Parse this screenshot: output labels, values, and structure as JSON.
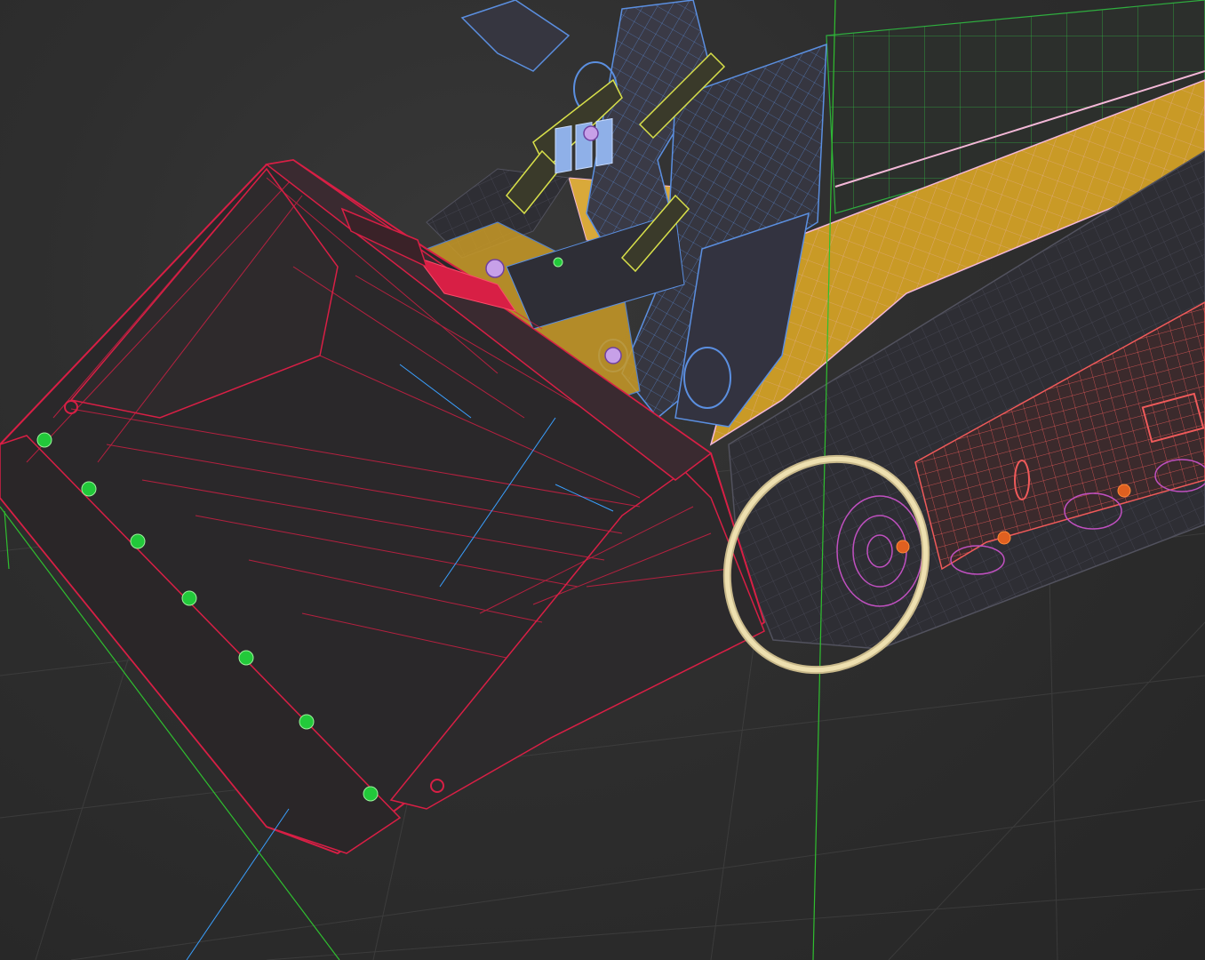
{
  "viewport": {
    "background": "#2b2b2b",
    "grid_color": "#4a4a4a"
  },
  "objects": [
    {
      "name": "bucket",
      "wire_color": "#d81f45"
    },
    {
      "name": "lift-arm",
      "wire_color": "#5b8fe0"
    },
    {
      "name": "body-panel",
      "wire_color": "#f4b8d8",
      "fill": "#c99a26"
    },
    {
      "name": "track",
      "wire_color": "#3a3a46"
    },
    {
      "name": "track-frame",
      "wire_color": "#f05a5a"
    },
    {
      "name": "road-wheels",
      "wire_color": "#c050c0"
    },
    {
      "name": "hydraulic-cylinders",
      "wire_color": "#d8e04a"
    },
    {
      "name": "hoses",
      "wire_color": "#e06020"
    },
    {
      "name": "bolts",
      "wire_color": "#22c93a"
    },
    {
      "name": "valve-block",
      "wire_color": "#8fb0e8"
    }
  ],
  "selection_ring": {
    "color": "#eee0b0"
  },
  "axes": {
    "x_color": "#2fbf2f",
    "y_color": "#2fbf2f",
    "z_color": "#3aa0ff"
  }
}
